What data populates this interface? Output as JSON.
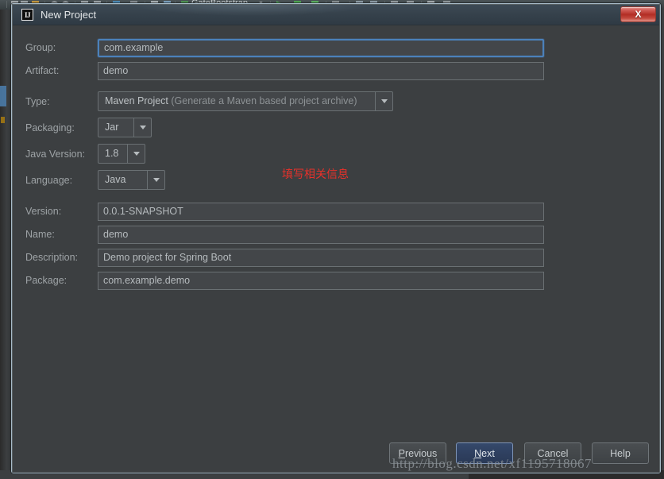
{
  "ide": {
    "toolbar_project_label": "GateBootstrap",
    "toolbar_dropdown_caret": "▼"
  },
  "dialog": {
    "title": "New Project",
    "logo_text": "IJ",
    "close_label": "X",
    "close_icon": "close-icon"
  },
  "form": {
    "fields": [
      {
        "label": "Group:",
        "value": "com.example",
        "type": "text",
        "focused": true
      },
      {
        "label": "Artifact:",
        "value": "demo",
        "type": "text",
        "focused": false
      },
      {
        "label": "Version:",
        "value": "0.0.1-SNAPSHOT",
        "type": "text",
        "focused": false
      },
      {
        "label": "Name:",
        "value": "demo",
        "type": "text",
        "focused": false
      },
      {
        "label": "Description:",
        "value": "Demo project for Spring Boot",
        "type": "text",
        "focused": false
      },
      {
        "label": "Package:",
        "value": "com.example.demo",
        "type": "text",
        "focused": false
      }
    ],
    "type_label": "Type:",
    "type_value": "Maven Project",
    "type_value_hint": "(Generate a Maven based project archive)",
    "packaging_label": "Packaging:",
    "packaging_value": "Jar",
    "java_version_label": "Java Version:",
    "java_version_value": "1.8",
    "language_label": "Language:",
    "language_value": "Java",
    "dropdown_arrow_icon": "chevron-down-icon"
  },
  "annotation": {
    "text": "填写相关信息",
    "color": "#e8312a"
  },
  "buttons": {
    "previous": {
      "pre": "",
      "mnemonic": "P",
      "post": "revious"
    },
    "next": {
      "pre": "",
      "mnemonic": "N",
      "post": "ext"
    },
    "cancel": {
      "label": "Cancel"
    },
    "help": {
      "label": "Help"
    }
  },
  "watermark": {
    "text": "http://blog.csdn.net/xf1195718067"
  },
  "colors": {
    "background": "#3c3f41",
    "field_background": "#434649",
    "focus_border": "#4b81bb",
    "default_button": "#2f4060",
    "annotation_red": "#e8312a",
    "titlebar": "#36424c"
  }
}
